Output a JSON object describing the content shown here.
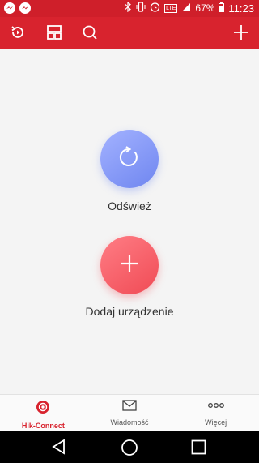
{
  "status_bar": {
    "battery": "67%",
    "time": "11:23",
    "network": "LTE"
  },
  "app_bar": {
    "icons": [
      "history-icon",
      "layout-icon",
      "search-icon",
      "add-icon"
    ]
  },
  "main": {
    "refresh_label": "Odśwież",
    "add_device_label": "Dodaj urządzenie"
  },
  "bottom_nav": {
    "items": [
      {
        "label": "Hik-Connect",
        "icon": "hik-connect-icon",
        "active": true
      },
      {
        "label": "Wiadomość",
        "icon": "envelope-icon",
        "active": false
      },
      {
        "label": "Więcej",
        "icon": "more-icon",
        "active": false
      }
    ]
  },
  "colors": {
    "brand": "#d8232e",
    "refresh_button": "#7d93f4",
    "add_button": "#f45a63"
  }
}
